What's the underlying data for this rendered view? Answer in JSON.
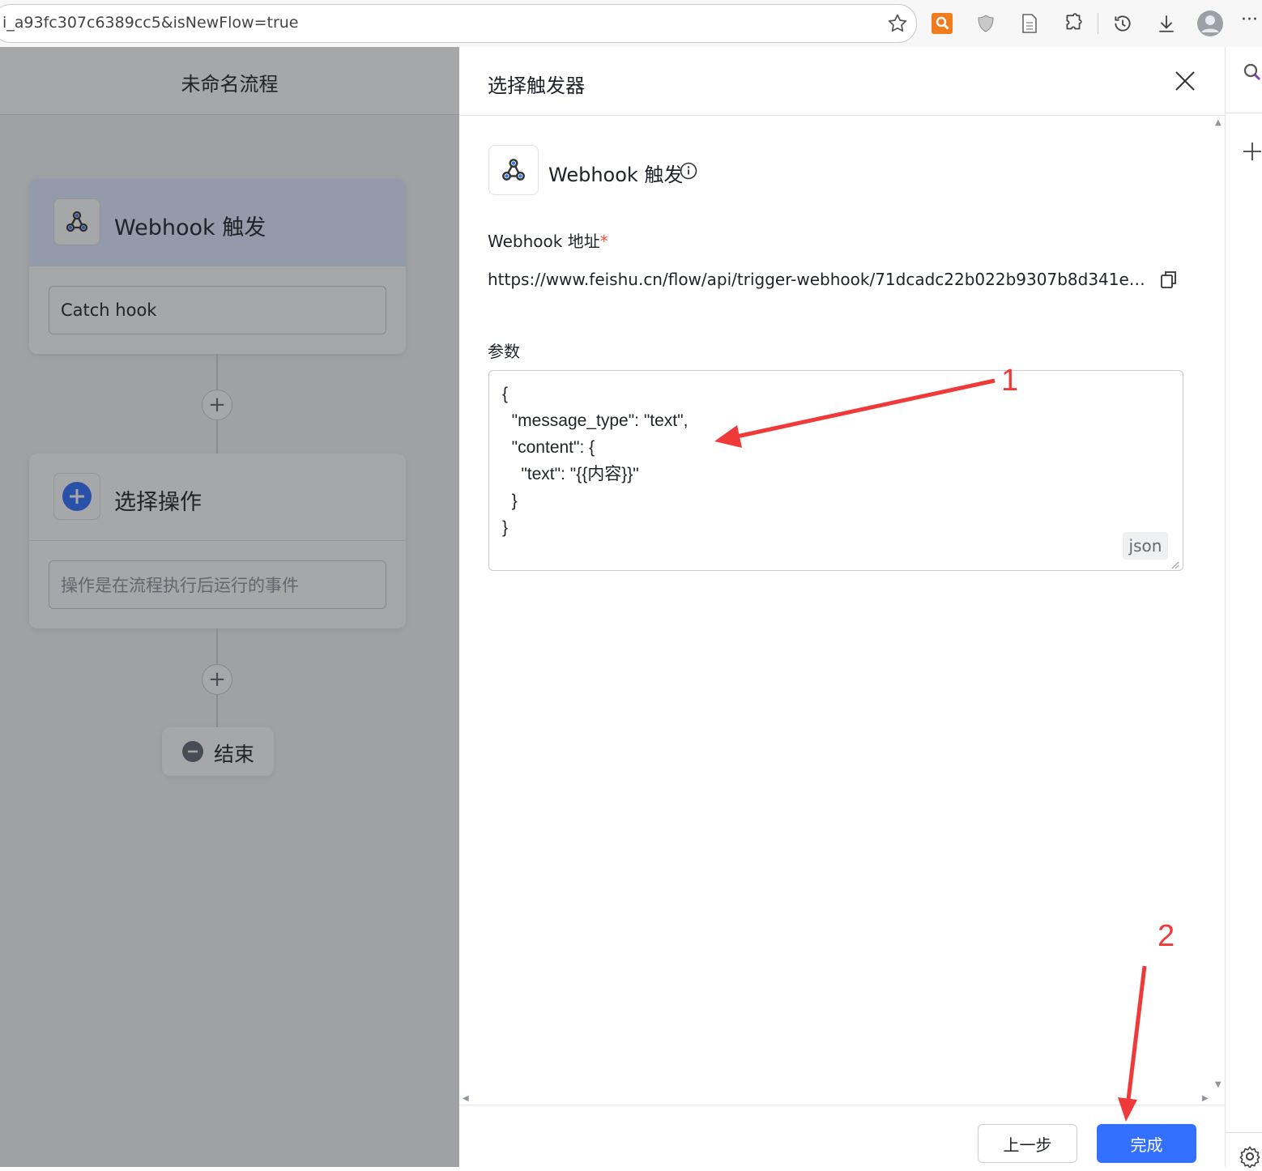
{
  "browser": {
    "url": "i_a93fc307c6389cc5&isNewFlow=true",
    "more_label": "···"
  },
  "canvas": {
    "flow_title": "未命名流程",
    "trigger_card": {
      "title": "Webhook 触发",
      "input_value": "Catch hook"
    },
    "action_card": {
      "title": "选择操作",
      "input_placeholder": "操作是在流程执行后运行的事件"
    },
    "add_step_label": "+",
    "end_label": "结束"
  },
  "panel": {
    "title": "选择触发器",
    "trigger_name": "Webhook 触发",
    "address_label": "Webhook 地址",
    "required_mark": "*",
    "address_value": "https://www.feishu.cn/flow/api/trigger-webhook/71dcadc22b022b9307b8d341ec33a8...",
    "params_label": "参数",
    "params_code": "{\n  \"message_type\": \"text\",\n  \"content\": {\n    \"text\": \"{{内容}}\"\n  }\n}",
    "params_format_badge": "json",
    "prev_button": "上一步",
    "done_button": "完成"
  },
  "annotations": {
    "arrow_1_label": "1",
    "arrow_2_label": "2",
    "color": "#f03a3a"
  },
  "colors": {
    "primary": "#3370ff",
    "required": "#f54a45"
  }
}
